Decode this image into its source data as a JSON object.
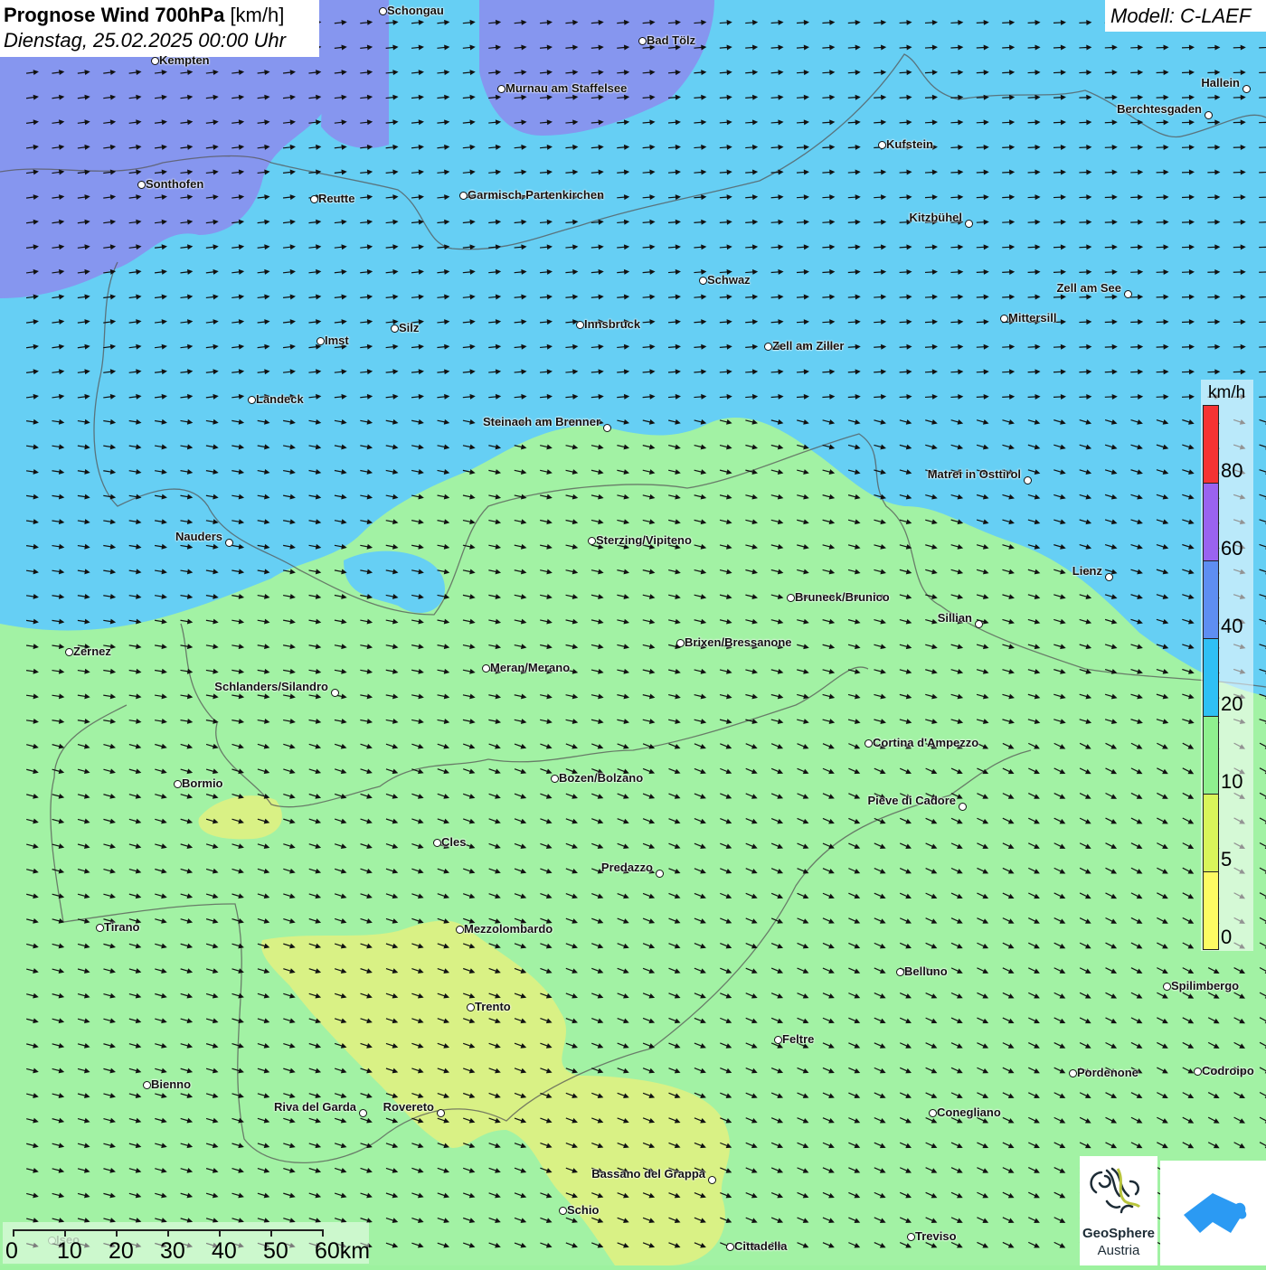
{
  "header": {
    "title_bold": "Prognose Wind 700hPa",
    "title_unit": "[km/h]",
    "datetime": "Dienstag, 25.02.2025 00:00 Uhr"
  },
  "model": "Modell: C-LAEF",
  "legend": {
    "unit": "km/h",
    "bins": [
      {
        "label": "80",
        "color": "#f53333"
      },
      {
        "label": "60",
        "color": "#9a63f0"
      },
      {
        "label": "40",
        "color": "#5e8ef2"
      },
      {
        "label": "20",
        "color": "#2fc0f5"
      },
      {
        "label": "10",
        "color": "#8ff08f"
      },
      {
        "label": "5",
        "color": "#d9f55a"
      },
      {
        "label": "0",
        "color": "#fdfb63"
      }
    ]
  },
  "scale_bar": {
    "labels": [
      "0",
      "10",
      "20",
      "30",
      "40",
      "50",
      "60km"
    ]
  },
  "colors": {
    "purple_zone": "#7f90ef",
    "blue_zone": "#5dcdf4",
    "green_zone": "#9df29f",
    "yellow_zone": "#d7f17e"
  },
  "cities": [
    "Schongau",
    "Bad Tölz",
    "Kempten",
    "Murnau am Staffelsee",
    "Hallein",
    "Berchtesgaden",
    "Kufstein",
    "Sonthofen",
    "Reutte",
    "Garmisch-Partenkirchen",
    "Kitzbühel",
    "Schwaz",
    "Zell am See",
    "Mittersill",
    "Innsbruck",
    "Silz",
    "Imst",
    "Zell am Ziller",
    "Landeck",
    "Steinach am Brenner",
    "Matrei in Osttirol",
    "Nauders",
    "Sterzing/Vipiteno",
    "Lienz",
    "Bruneck/Brunico",
    "Sillian",
    "Brixen/Bressanone",
    "Zernez",
    "Meran/Merano",
    "Schlanders/Silandro",
    "Cortina d'Ampezzo",
    "Bormio",
    "Bozen/Bolzano",
    "Pieve di Cadore",
    "Cles",
    "Predazzo",
    "Tirano",
    "Mezzolombardo",
    "Belluno",
    "Spilimbergo",
    "Trento",
    "Feltre",
    "Pordenone",
    "Codroipo",
    "Bienno",
    "Riva del Garda",
    "Rovereto",
    "Conegliano",
    "Bassano del Grappa",
    "Schio",
    "Treviso",
    "Cittadella",
    "Iseo"
  ],
  "logos": {
    "geosphere_line1": "GeoSphere",
    "geosphere_line2": "Austria"
  }
}
